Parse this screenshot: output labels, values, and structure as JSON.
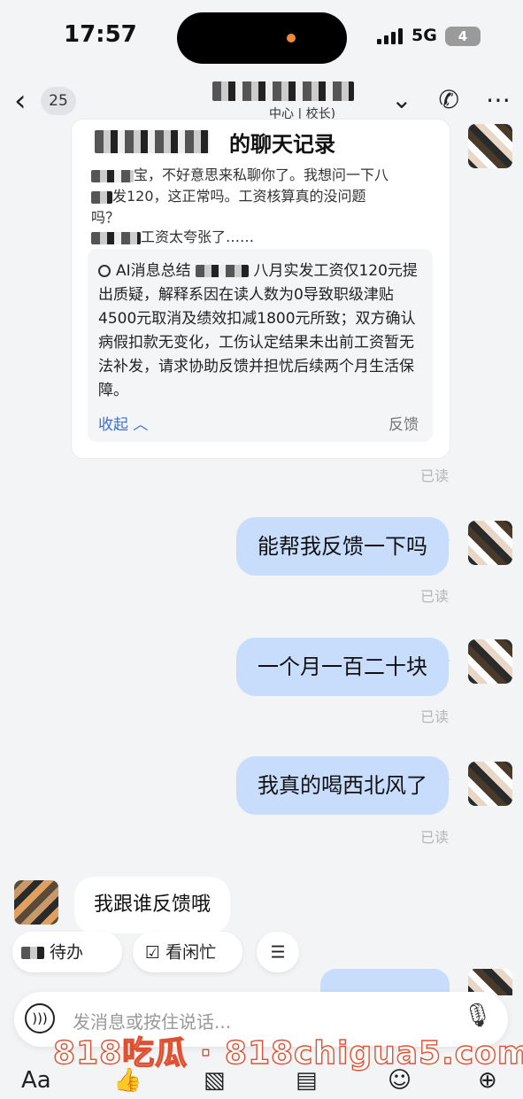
{
  "status": {
    "time": "17:57",
    "network": "5G",
    "battery": "4"
  },
  "nav": {
    "unread": "25",
    "subtitle": "中心 | 校长)"
  },
  "card": {
    "title": "的聊天记录",
    "line1": "宝，不好意思来私聊你了。我想问一下八",
    "line2": "发120，这正常吗。工资核算真的没问题",
    "line3": "吗？",
    "line4": "工资太夸张了……",
    "summary_label": "AI消息总结",
    "summary_body": "八月实发工资仅120元提出质疑，解释系因在读人数为0导致职级津贴4500元取消及绩效扣减1800元所致；双方确认病假扣款无变化，工伤认定结果未出前工资暂无法补发，请求协助反馈并担忧后续两个月生活保障。",
    "collapse": "收起",
    "feedback": "反馈",
    "read": "已读"
  },
  "messages": [
    {
      "text": "能帮我反馈一下吗",
      "status": "已读"
    },
    {
      "text": "一个月一百二十块",
      "status": "已读"
    },
    {
      "text": "我真的喝西北风了",
      "status": "已读"
    },
    {
      "text": "我跟谁反馈哦"
    }
  ],
  "chips": {
    "todo": "待办",
    "schedule": "看闲忙",
    "menu": "☰"
  },
  "input": {
    "placeholder": "发消息或按住说话..."
  },
  "watermark": "818吃瓜 · 818chigua5.com",
  "toolbar": {
    "font": "Aa"
  }
}
